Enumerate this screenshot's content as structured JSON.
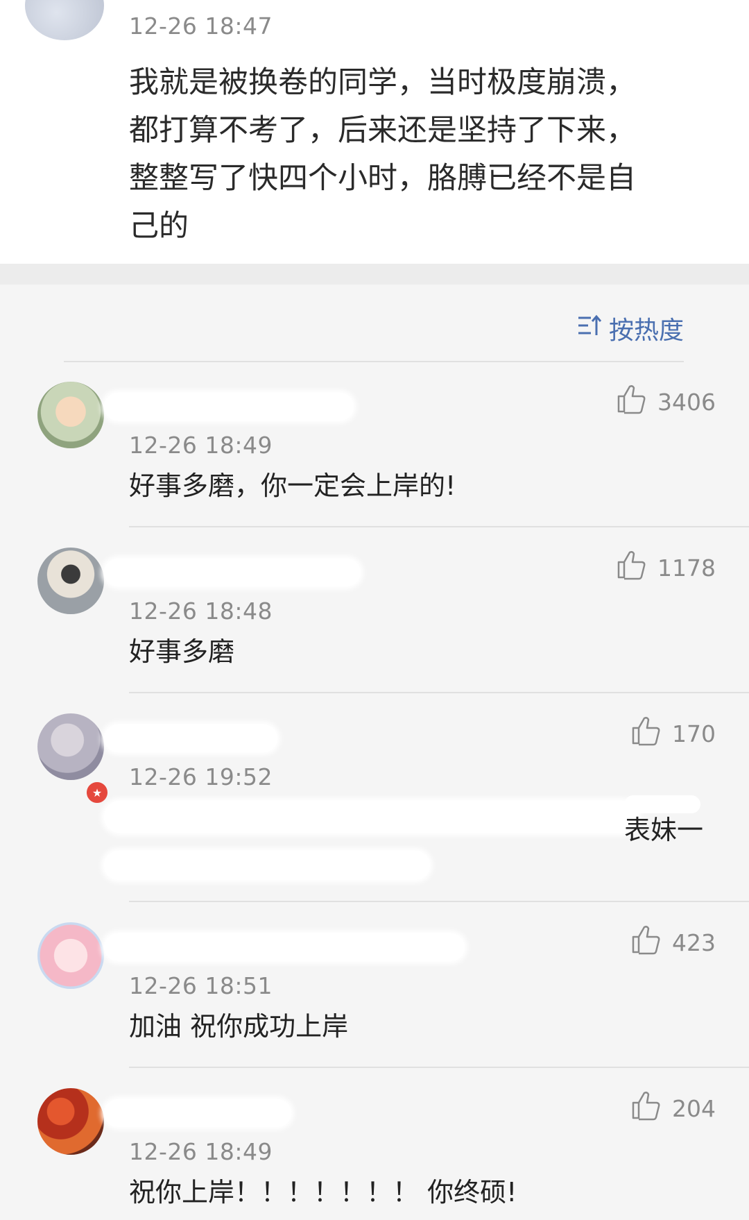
{
  "top_comment": {
    "timestamp": "12-26 18:47",
    "text_lines": [
      "我就是被换卷的同学，当时极度崩溃，",
      "都打算不考了，后来还是坚持了下来，",
      "整整写了快四个小时，胳膊已经不是自",
      "己的"
    ]
  },
  "sort": {
    "icon": "sort-icon",
    "label": "按热度"
  },
  "like_icon": "thumbs-up-icon",
  "replies": [
    {
      "timestamp": "12-26 18:49",
      "text": "好事多磨，你一定会上岸的!",
      "likes": "3406"
    },
    {
      "timestamp": "12-26 18:48",
      "text": "好事多磨",
      "likes": "1178"
    },
    {
      "timestamp": "12-26 19:52",
      "text_visible": "表妹一",
      "likes": "170"
    },
    {
      "timestamp": "12-26 18:51",
      "text": "加油 祝你成功上岸",
      "likes": "423"
    },
    {
      "timestamp": "12-26 18:49",
      "text": "祝你上岸！！！！！！！ 你终硕!",
      "likes": "204"
    }
  ],
  "colors": {
    "accent": "#4a6fb0",
    "muted": "#8a8a8a",
    "page_bg": "#f5f5f5"
  }
}
